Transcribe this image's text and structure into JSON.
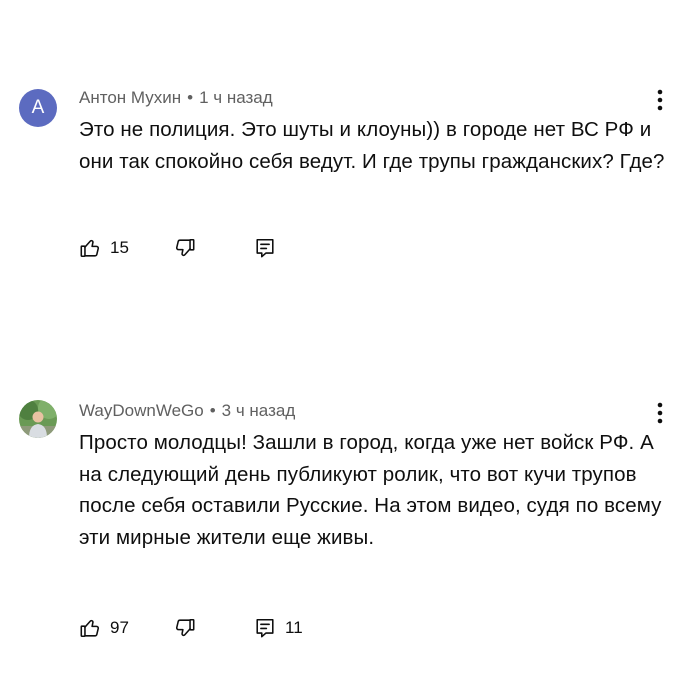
{
  "comments": [
    {
      "author": "Антон Мухин",
      "separator": "•",
      "time": "1 ч назад",
      "avatar_letter": "А",
      "avatar_color": "#5c6bc0",
      "text": "Это не полиция. Это шуты и клоуны)) в городе нет ВС РФ и они так спокойно себя ведут. И где трупы гражданских? Где?",
      "likes": "15",
      "replies": "",
      "icons": [
        "thumb-up-icon",
        "thumb-down-icon",
        "reply-icon",
        "more-vert-icon"
      ]
    },
    {
      "author": "WayDownWeGo",
      "separator": "•",
      "time": "3 ч назад",
      "avatar_letter": "",
      "text": "Просто молодцы! Зашли в город, когда уже нет войск РФ. А на следующий день публикуют ролик, что вот кучи трупов после себя оставили Русские. На этом видео, судя по всему эти мирные жители еще живы.",
      "likes": "97",
      "replies": "11",
      "icons": [
        "thumb-up-icon",
        "thumb-down-icon",
        "reply-icon",
        "more-vert-icon"
      ]
    }
  ]
}
